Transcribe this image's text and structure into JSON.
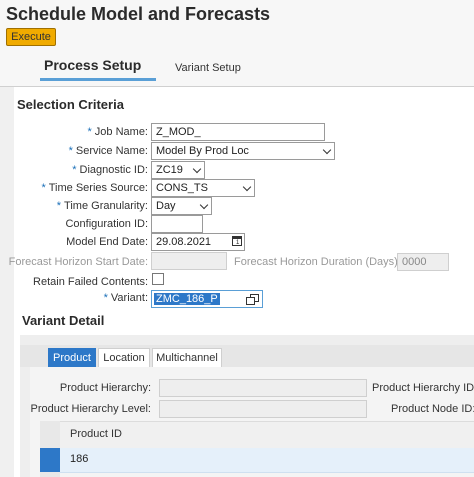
{
  "header": {
    "title": "Schedule Model and Forecasts",
    "execute_label": "Execute"
  },
  "tabs": {
    "process_setup": "Process Setup",
    "variant_setup": "Variant Setup"
  },
  "selection_criteria": {
    "title": "Selection Criteria",
    "fields": {
      "job_name": {
        "label": "Job Name:",
        "value": "Z_MOD_"
      },
      "service_name": {
        "label": "Service Name:",
        "value": "Model By Prod Loc"
      },
      "diagnostic_id": {
        "label": "Diagnostic ID:",
        "value": "ZC19"
      },
      "time_series_source": {
        "label": "Time Series Source:",
        "value": "CONS_TS"
      },
      "time_granularity": {
        "label": "Time Granularity:",
        "value": "Day"
      },
      "configuration_id": {
        "label": "Configuration ID:",
        "value": ""
      },
      "model_end_date": {
        "label": "Model End Date:",
        "value": "29.08.2021"
      },
      "forecast_horizon_start_date": {
        "label": "Forecast Horizon Start Date:",
        "value": ""
      },
      "forecast_horizon_duration": {
        "label": "Forecast Horizon Duration (Days):",
        "value": "0000"
      },
      "retain_failed_contents": {
        "label": "Retain Failed Contents:",
        "checked": false
      },
      "variant": {
        "label": "Variant:",
        "value": "ZMC_186_P"
      }
    },
    "required_marker": "*"
  },
  "variant_detail": {
    "title": "Variant Detail",
    "tabs": [
      "Product",
      "Location",
      "Multichannel"
    ],
    "active_tab": "Product",
    "product_hierarchy_label": "Product Hierarchy:",
    "product_hierarchy_id_label": "Product Hierarchy ID:",
    "product_hierarchy_level_label": "Product Hierarchy Level:",
    "product_node_id_label": "Product Node ID:",
    "table": {
      "columns": [
        "Product ID"
      ],
      "rows": [
        [
          "186"
        ]
      ]
    }
  },
  "colors": {
    "accent_blue": "#2d78c8",
    "execute_button": "#f0ab00",
    "required_star": "#1a6fb8"
  }
}
